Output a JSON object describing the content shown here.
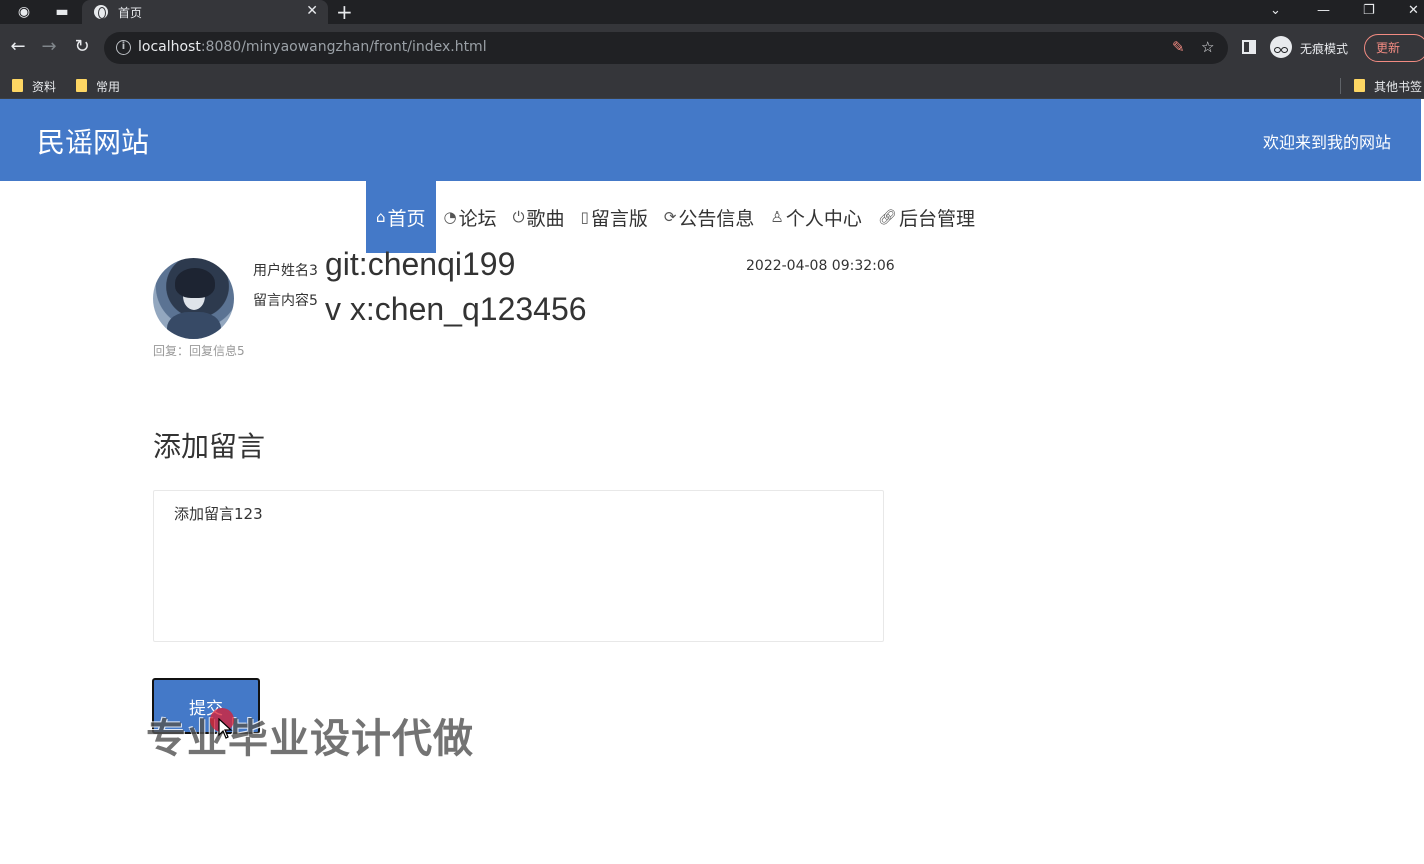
{
  "browser": {
    "tab_title": "首页",
    "url_host": "localhost",
    "url_path": ":8080/minyaowangzhan/front/index.html",
    "incognito_label": "无痕模式",
    "update_label": "更新",
    "bookmarks": [
      "资料",
      "常用"
    ],
    "other_bookmarks": "其他书签"
  },
  "site": {
    "title": "民谣网站",
    "welcome": "欢迎来到我的网站"
  },
  "nav": [
    {
      "label": "首页",
      "icon": "home-icon"
    },
    {
      "label": "论坛",
      "icon": "dashboard-icon"
    },
    {
      "label": "歌曲",
      "icon": "power-icon"
    },
    {
      "label": "留言版",
      "icon": "note-icon"
    },
    {
      "label": "公告信息",
      "icon": "refresh-icon"
    },
    {
      "label": "个人中心",
      "icon": "user-icon"
    },
    {
      "label": "后台管理",
      "icon": "link-icon"
    }
  ],
  "message": {
    "user_label": "用户姓名3",
    "content_label": "留言内容5",
    "time": "2022-04-08 09:32:06",
    "reply": "回复：回复信息5"
  },
  "overlay": {
    "git": "git:chenqi199",
    "vx": "v x:chen_q123456",
    "watermark": "专业毕业设计代做"
  },
  "add_message": {
    "title": "添加留言",
    "value": "添加留言123",
    "submit_label": "提交"
  }
}
